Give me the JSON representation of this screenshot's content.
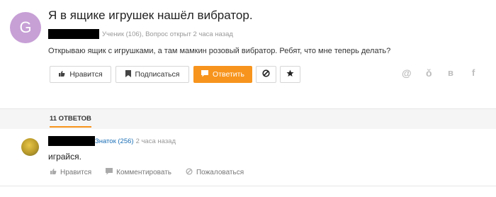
{
  "question": {
    "avatar_letter": "G",
    "title": "Я в ящике игрушек нашёл вибратор.",
    "author_meta": "Ученик (106), Вопрос открыт 2 часа назад",
    "body": "Открываю ящик с игрушками, а там мамкин розовый вибратор. Ребят, что мне теперь делать?",
    "actions": {
      "like_label": "Нравится",
      "subscribe_label": "Подписаться",
      "answer_label": "Ответить"
    },
    "share": {
      "mail": "@",
      "ok": "ǒ",
      "vk": "в",
      "fb": "f"
    },
    "colors": {
      "accent": "#f7941d",
      "avatar_bg": "#c7a0d6"
    }
  },
  "answers_tab": {
    "label": "11 ОТВЕТОВ"
  },
  "answer": {
    "rank": "Знаток (256)",
    "time": "2 часа назад",
    "text": "играйся.",
    "actions": {
      "like_label": "Нравится",
      "comment_label": "Комментировать",
      "report_label": "Пожаловаться"
    }
  }
}
